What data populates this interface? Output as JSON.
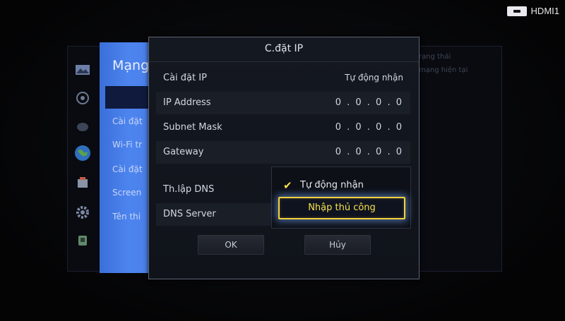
{
  "hdmi": {
    "label": "HDMI1",
    "icon": "hdmi-input-icon"
  },
  "background": {
    "text_line_1": "rạng thái",
    "text_line_2": "mạng hiện tại"
  },
  "side_icons": [
    "picture-icon",
    "sound-icon",
    "broadcast-icon",
    "network-globe-icon",
    "smart-features-icon",
    "gear-icon",
    "support-icon"
  ],
  "network_menu": {
    "title": "Mạng",
    "items": [
      "Cài đặt",
      "Wi-Fi tr",
      "Cài đặt",
      "Screen",
      "Tên thi"
    ]
  },
  "dialog": {
    "title": "C.đặt IP",
    "rows": [
      {
        "label": "Cài đặt IP",
        "value": "Tự động nhận"
      },
      {
        "label": "IP Address",
        "value": "0 . 0 . 0 . 0"
      },
      {
        "label": "Subnet Mask",
        "value": "0 . 0 . 0 . 0"
      },
      {
        "label": "Gateway",
        "value": "0 . 0 . 0 . 0"
      },
      {
        "label": "Th.lập DNS",
        "value": ""
      },
      {
        "label": "DNS Server",
        "value": ""
      }
    ],
    "dropdown": {
      "options": [
        "Tự động nhận",
        "Nhập thủ công"
      ],
      "checked_index": 0,
      "focused_index": 1
    },
    "buttons": {
      "ok": "OK",
      "cancel": "Hủy"
    }
  },
  "colors": {
    "focus_border": "#f2d23a",
    "focus_text": "#f5e24a",
    "panel_blue": "#4d85f0"
  }
}
